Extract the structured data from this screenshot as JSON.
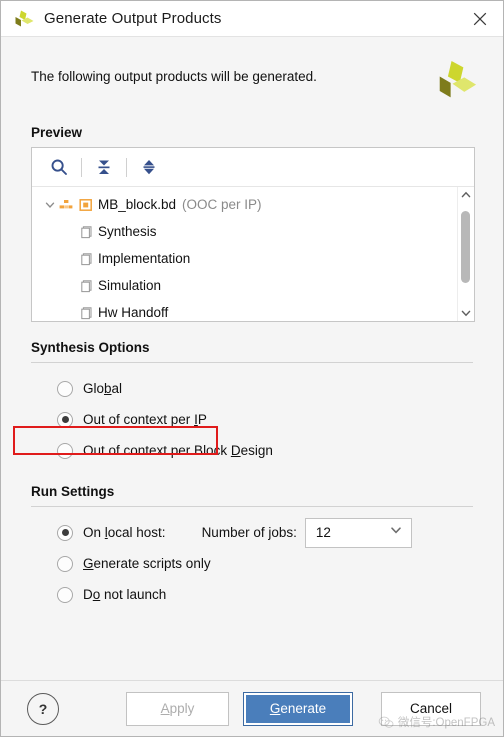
{
  "window": {
    "title": "Generate Output Products",
    "logo_icon": "xilinx-vivado-logo",
    "close_icon": "close-icon"
  },
  "intro": {
    "text": "The following output products will be generated.",
    "logo_icon": "xilinx-vivado-logo-large"
  },
  "preview": {
    "heading": "Preview",
    "toolbar": [
      {
        "name": "search-icon",
        "tooltip": "Search"
      },
      {
        "name": "collapse-all-icon",
        "tooltip": "Collapse All"
      },
      {
        "name": "expand-all-icon",
        "tooltip": "Expand All"
      }
    ],
    "tree": {
      "root": {
        "label": "MB_block.bd",
        "note": "(OOC per IP)",
        "expanded_icon": "chevron-down-icon",
        "type_icon": "block-design-icon",
        "state_icon": "orange-square-icon"
      },
      "children": [
        {
          "label": "Synthesis",
          "icon": "file-icon"
        },
        {
          "label": "Implementation",
          "icon": "file-icon"
        },
        {
          "label": "Simulation",
          "icon": "file-icon"
        },
        {
          "label": "Hw Handoff",
          "icon": "file-icon"
        }
      ]
    },
    "scrollbar": {
      "up_icon": "chevron-up-icon",
      "down_icon": "chevron-down-icon"
    }
  },
  "synthesis_options": {
    "heading": "Synthesis Options",
    "options": [
      {
        "label_pre": "Glo",
        "mnemonic": "b",
        "label_post": "al",
        "selected": false
      },
      {
        "label_pre": "Out of context per ",
        "mnemonic": "I",
        "label_post": "P",
        "selected": true
      },
      {
        "label_pre": "Out of context per Block ",
        "mnemonic": "D",
        "label_post": "esign",
        "selected": false
      }
    ],
    "highlight_color": "#e01b1b"
  },
  "run_settings": {
    "heading": "Run Settings",
    "options": [
      {
        "label_pre": "On ",
        "mnemonic": "l",
        "label_post": "ocal host:",
        "selected": true
      },
      {
        "label_pre": "",
        "mnemonic": "G",
        "label_post": "enerate scripts only",
        "selected": false
      },
      {
        "label_pre": "D",
        "mnemonic": "o",
        "label_post": " not launch",
        "selected": false
      }
    ],
    "jobs": {
      "label": "Number of jobs:",
      "value": "12",
      "chevron_icon": "chevron-down-icon"
    }
  },
  "footer": {
    "help_label": "?",
    "apply_label": "Apply",
    "apply_mnemonic": "A",
    "generate_pre": "G",
    "generate_post": "enerate",
    "cancel_label": "Cancel",
    "generate_color": "#4a7ebb"
  },
  "watermark": {
    "icon": "wechat-icon",
    "text": "微信号:OpenFPGA"
  }
}
